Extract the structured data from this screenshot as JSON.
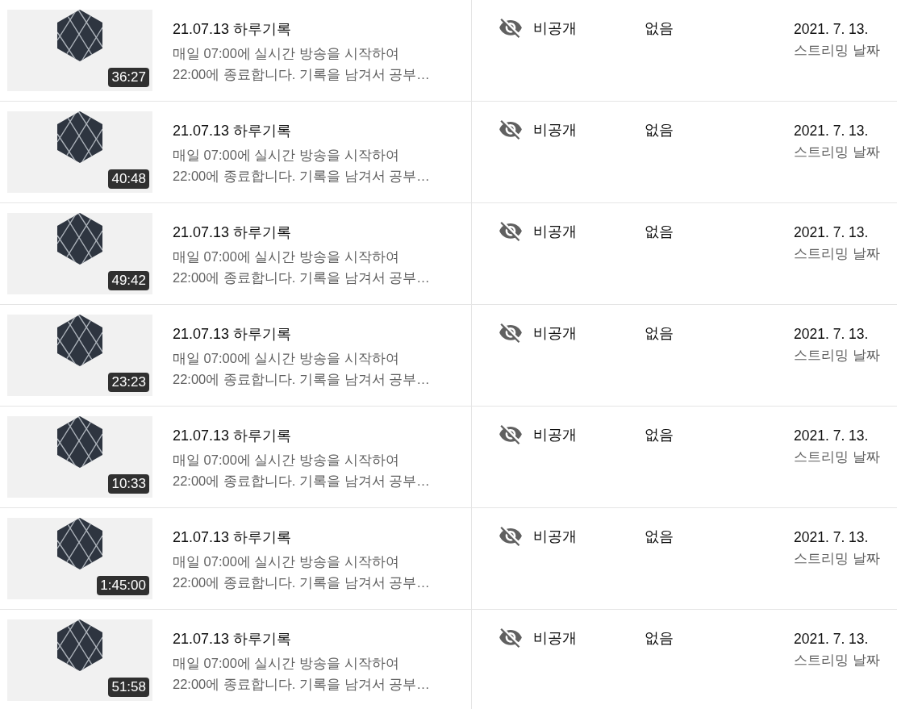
{
  "rows": [
    {
      "duration": "36:27",
      "title": "21.07.13 하루기록",
      "description": [
        "매일 07:00에 실시간 방송을 시작하여",
        "22:00에 종료합니다. 기록을 남겨서 공부…"
      ],
      "visibility": {
        "kind": "private",
        "label": "비공개"
      },
      "restrictions": "없음",
      "date": "2021. 7. 13.",
      "date_type": "스트리밍 날짜"
    },
    {
      "duration": "40:48",
      "title": "21.07.13 하루기록",
      "description": [
        "매일 07:00에 실시간 방송을 시작하여",
        "22:00에 종료합니다. 기록을 남겨서 공부…"
      ],
      "visibility": {
        "kind": "private",
        "label": "비공개"
      },
      "restrictions": "없음",
      "date": "2021. 7. 13.",
      "date_type": "스트리밍 날짜"
    },
    {
      "duration": "49:42",
      "title": "21.07.13 하루기록",
      "description": [
        "매일 07:00에 실시간 방송을 시작하여",
        "22:00에 종료합니다. 기록을 남겨서 공부…"
      ],
      "visibility": {
        "kind": "private",
        "label": "비공개"
      },
      "restrictions": "없음",
      "date": "2021. 7. 13.",
      "date_type": "스트리밍 날짜"
    },
    {
      "duration": "23:23",
      "title": "21.07.13 하루기록",
      "description": [
        "매일 07:00에 실시간 방송을 시작하여",
        "22:00에 종료합니다. 기록을 남겨서 공부…"
      ],
      "visibility": {
        "kind": "private",
        "label": "비공개"
      },
      "restrictions": "없음",
      "date": "2021. 7. 13.",
      "date_type": "스트리밍 날짜"
    },
    {
      "duration": "10:33",
      "title": "21.07.13 하루기록",
      "description": [
        "매일 07:00에 실시간 방송을 시작하여",
        "22:00에 종료합니다. 기록을 남겨서 공부…"
      ],
      "visibility": {
        "kind": "private",
        "label": "비공개"
      },
      "restrictions": "없음",
      "date": "2021. 7. 13.",
      "date_type": "스트리밍 날짜"
    },
    {
      "duration": "1:45:00",
      "title": "21.07.13 하루기록",
      "description": [
        "매일 07:00에 실시간 방송을 시작하여",
        "22:00에 종료합니다. 기록을 남겨서 공부…"
      ],
      "visibility": {
        "kind": "private",
        "label": "비공개"
      },
      "restrictions": "없음",
      "date": "2021. 7. 13.",
      "date_type": "스트리밍 날짜"
    },
    {
      "duration": "51:58",
      "title": "21.07.13 하루기록",
      "description": [
        "매일 07:00에 실시간 방송을 시작하여",
        "22:00에 종료합니다. 기록을 남겨서 공부…"
      ],
      "visibility": {
        "kind": "private",
        "label": "비공개"
      },
      "restrictions": "없음",
      "date": "2021. 7. 13.",
      "date_type": "스트리밍 날짜"
    }
  ]
}
